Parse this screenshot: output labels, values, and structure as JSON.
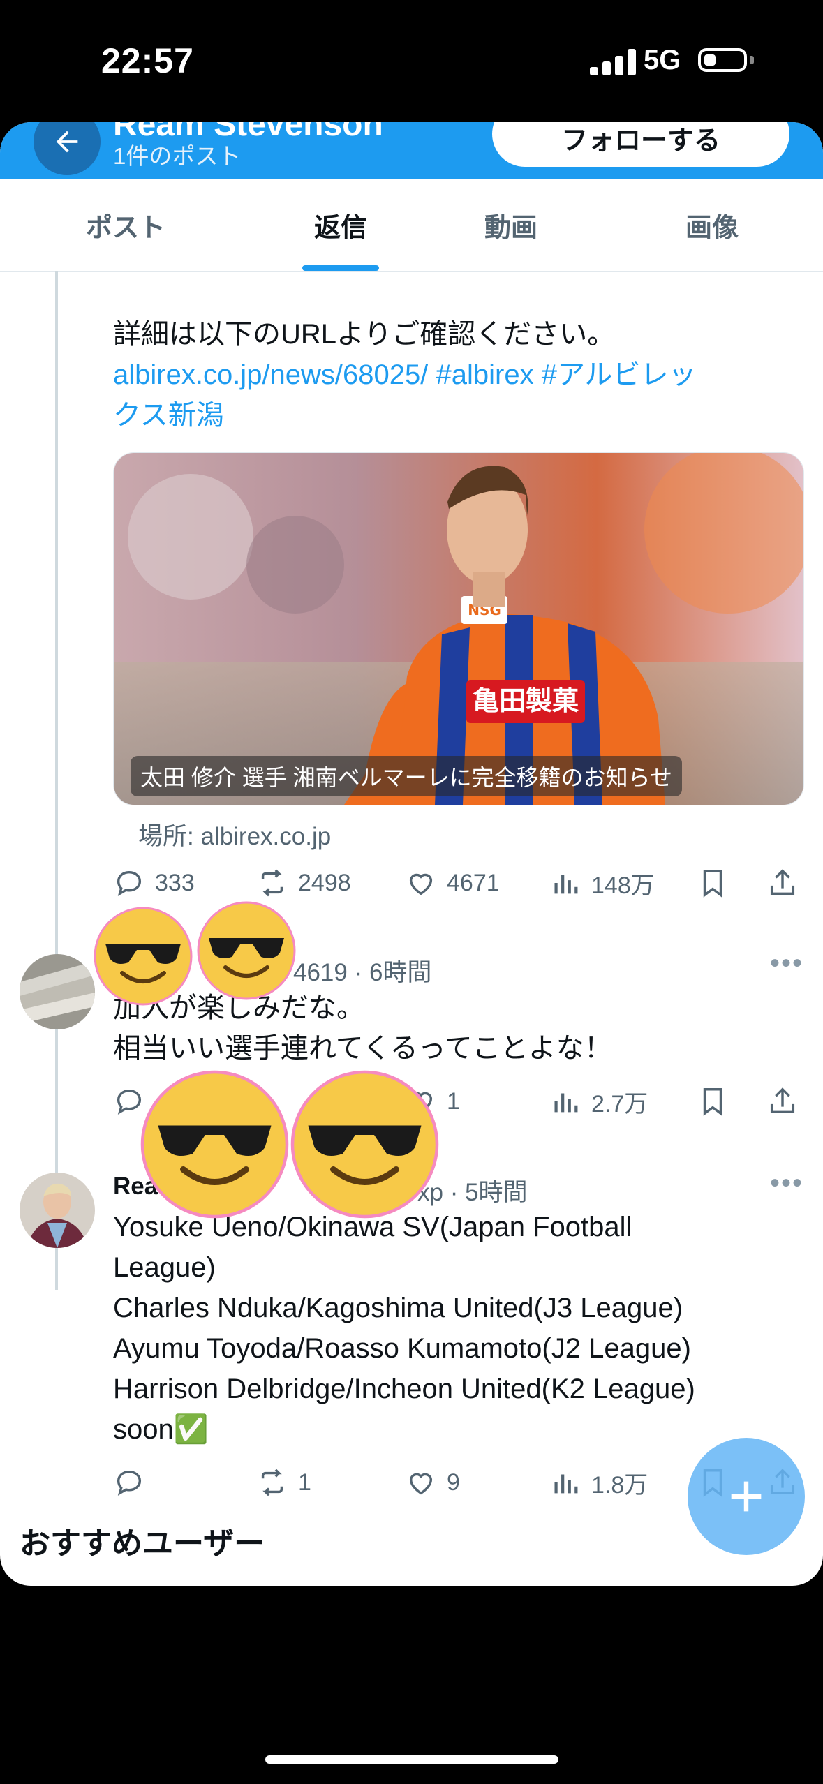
{
  "status_bar": {
    "time": "22:57",
    "network": "5G"
  },
  "profile": {
    "name": "Ream Stevenson",
    "post_count": "1件のポスト",
    "follow_label": "フォローする"
  },
  "tabs": [
    {
      "label": "ポスト"
    },
    {
      "label": "返信"
    },
    {
      "label": "動画"
    },
    {
      "label": "画像"
    }
  ],
  "tweet1": {
    "line1": "詳細は以下のURLよりご確認ください。",
    "link_line": "albirex.co.jp/news/68025/ #albirex #アルビレッ",
    "link_line2": "クス新潟",
    "card_caption": "太田 修介 選手 湘南ベルマーレに完全移籍のお知らせ",
    "card_source": "場所: albirex.co.jp",
    "replies": "333",
    "retweets": "2498",
    "likes": "4671",
    "views": "148万"
  },
  "tweet2": {
    "meta": "4619 · 6時間",
    "line1": "加入が楽しみだな。",
    "line2": "相当いい選手連れてくるってことよな！",
    "likes": "1",
    "views": "2.7万"
  },
  "tweet3": {
    "author": "Rea",
    "meta": "xp · 5時間",
    "lines": [
      "Yosuke Ueno/Okinawa SV(Japan Football",
      "League)",
      "Charles Nduka/Kagoshima United(J3 League)",
      "Ayumu Toyoda/Roasso Kumamoto(J2 League)",
      "Harrison Delbridge/Incheon United(K2 League)",
      "soon✅"
    ],
    "retweets": "1",
    "likes": "9",
    "views": "1.8万"
  },
  "recommended": "おすすめユーザー",
  "colors": {
    "accent": "#1d9bf0",
    "text": "#0f1419",
    "muted": "#536471"
  }
}
